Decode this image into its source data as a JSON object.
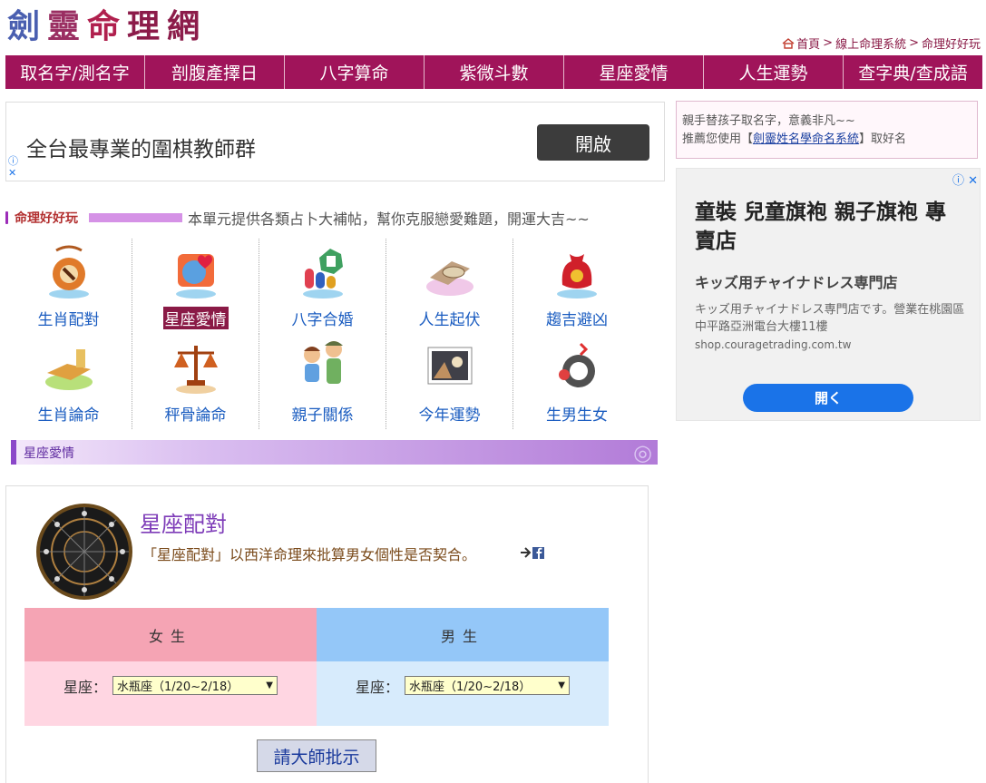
{
  "logo": {
    "chars": [
      "劍",
      "靈",
      "命",
      "理",
      "網"
    ]
  },
  "breadcrumb": {
    "home": "首頁",
    "sep1": ">",
    "level1": "線上命理系統",
    "sep2": ">",
    "level2": "命理好好玩"
  },
  "nav": {
    "items": [
      "取名字/測名字",
      "剖腹產擇日",
      "八字算命",
      "紫微斗數",
      "星座愛情",
      "人生運勢",
      "查字典/查成語"
    ]
  },
  "ad1": {
    "text": "全台最專業的圍棋教師群",
    "button": "開啟",
    "adchoices": "ⓘ",
    "close": "✕"
  },
  "promo": {
    "line1": "親手替孩子取名字，意義非凡~~",
    "line2_prefix": "推薦您使用【",
    "line2_link": "劍靈姓名學命名系統",
    "line2_suffix": "】取好名"
  },
  "ad2": {
    "badge": "ⓘ ✕",
    "headline": "童裝 兒童旗袍 親子旗袍 專賣店",
    "sub": "キッズ用チャイナドレス専門店",
    "desc": "キッズ用チャイナドレス専門店です。營業在桃園區中平路亞洲電台大樓11樓",
    "domain": "shop.couragetrading.com.tw",
    "button": "開く"
  },
  "section": {
    "title": "命理好好玩",
    "desc": "本單元提供各類占卜大補帖，幫你克服戀愛難題，開運大吉~~"
  },
  "grid": {
    "row1": [
      "生肖配對",
      "星座愛情",
      "八字合婚",
      "人生起伏",
      "趨吉避凶"
    ],
    "row2": [
      "生肖論命",
      "秤骨論命",
      "親子關係",
      "今年運勢",
      "生男生女"
    ]
  },
  "secbar": {
    "title": "星座愛情",
    "watermark": "◎"
  },
  "panel": {
    "title": "星座配對",
    "desc": "「星座配對」以西洋命理來批算男女個性是否契合。",
    "female_header": "女生",
    "male_header": "男生",
    "field_label": "星座：",
    "female_value": "水瓶座（1/20~2/18）",
    "male_value": "水瓶座（1/20~2/18）",
    "submit": "請大師批示"
  },
  "colors": {
    "nav": "#a0145a",
    "female": "#f5a4b4",
    "male": "#94c7f8",
    "link": "#1a5cc0"
  }
}
